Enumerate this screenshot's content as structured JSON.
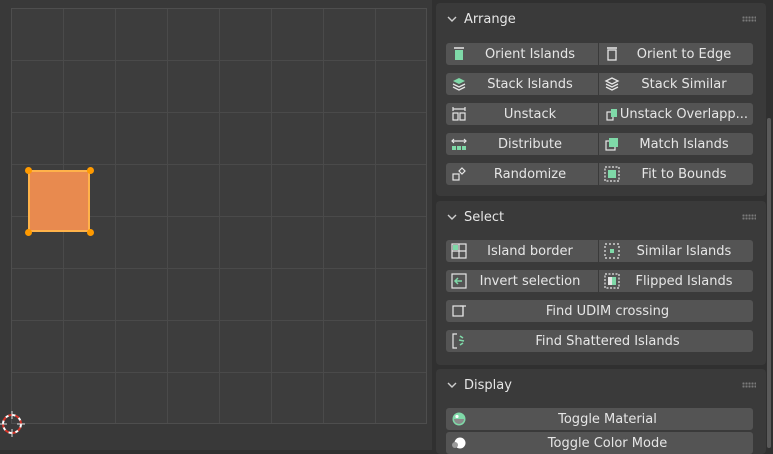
{
  "arrange": {
    "title": "Arrange",
    "buttons": {
      "orient_islands": "Orient Islands",
      "orient_to_edge": "Orient to Edge",
      "stack_islands": "Stack Islands",
      "stack_similar": "Stack Similar",
      "unstack": "Unstack",
      "unstack_overlapped": "Unstack Overlapp...",
      "distribute": "Distribute",
      "match_islands": "Match Islands",
      "randomize": "Randomize",
      "fit_to_bounds": "Fit to Bounds"
    }
  },
  "select": {
    "title": "Select",
    "buttons": {
      "island_border": "Island border",
      "similar_islands": "Similar Islands",
      "invert_selection": "Invert selection",
      "flipped_islands": "Flipped Islands",
      "find_udim_crossing": "Find UDIM crossing",
      "find_shattered_islands": "Find Shattered Islands"
    }
  },
  "display": {
    "title": "Display",
    "buttons": {
      "toggle_material": "Toggle Material",
      "toggle_color_mode": "Toggle Color Mode"
    }
  },
  "colors": {
    "island_fill": "#e88a4f",
    "island_edge": "#ffb24a",
    "button_bg": "#545454",
    "icon_accent": "#7fd9a8"
  }
}
